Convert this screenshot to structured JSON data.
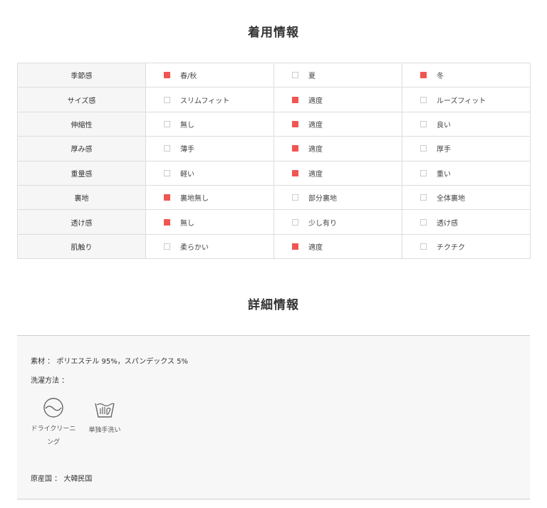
{
  "wear_title": "着用情報",
  "detail_title": "詳細情報",
  "wear_rows": [
    {
      "label": "季節感",
      "options": [
        {
          "text": "春/秋",
          "checked": true
        },
        {
          "text": "夏",
          "checked": false
        },
        {
          "text": "冬",
          "checked": true
        }
      ]
    },
    {
      "label": "サイズ感",
      "options": [
        {
          "text": "スリムフィット",
          "checked": false
        },
        {
          "text": "適度",
          "checked": true
        },
        {
          "text": "ルーズフィット",
          "checked": false
        }
      ]
    },
    {
      "label": "伸縮性",
      "options": [
        {
          "text": "無し",
          "checked": false
        },
        {
          "text": "適度",
          "checked": true
        },
        {
          "text": "良い",
          "checked": false
        }
      ]
    },
    {
      "label": "厚み感",
      "options": [
        {
          "text": "薄手",
          "checked": false
        },
        {
          "text": "適度",
          "checked": true
        },
        {
          "text": "厚手",
          "checked": false
        }
      ]
    },
    {
      "label": "重量感",
      "options": [
        {
          "text": "軽い",
          "checked": false
        },
        {
          "text": "適度",
          "checked": true
        },
        {
          "text": "重い",
          "checked": false
        }
      ]
    },
    {
      "label": "裏地",
      "options": [
        {
          "text": "裏地無し",
          "checked": true
        },
        {
          "text": "部分裏地",
          "checked": false
        },
        {
          "text": "全体裏地",
          "checked": false
        }
      ]
    },
    {
      "label": "透け感",
      "options": [
        {
          "text": "無し",
          "checked": true
        },
        {
          "text": "少し有り",
          "checked": false
        },
        {
          "text": "透け感",
          "checked": false
        }
      ]
    },
    {
      "label": "肌触り",
      "options": [
        {
          "text": "柔らかい",
          "checked": false
        },
        {
          "text": "適度",
          "checked": true
        },
        {
          "text": "チクチク",
          "checked": false
        }
      ]
    }
  ],
  "detail": {
    "material": "素材 ： ポリエステル 95%，スパンデックス 5%",
    "wash_label": "洗濯方法 ：",
    "care_icons": [
      {
        "icon": "dry-cleaning-icon",
        "label": "ドライクリーニング"
      },
      {
        "icon": "hand-wash-icon",
        "label": "単独手洗い"
      }
    ],
    "origin": "原産国 ： 大韓民国"
  },
  "colors": {
    "checked": "#f05552",
    "unchecked_border": "#cccccc",
    "row_header_bg": "#f6f6f6",
    "detail_bg": "#f7f7f7"
  }
}
